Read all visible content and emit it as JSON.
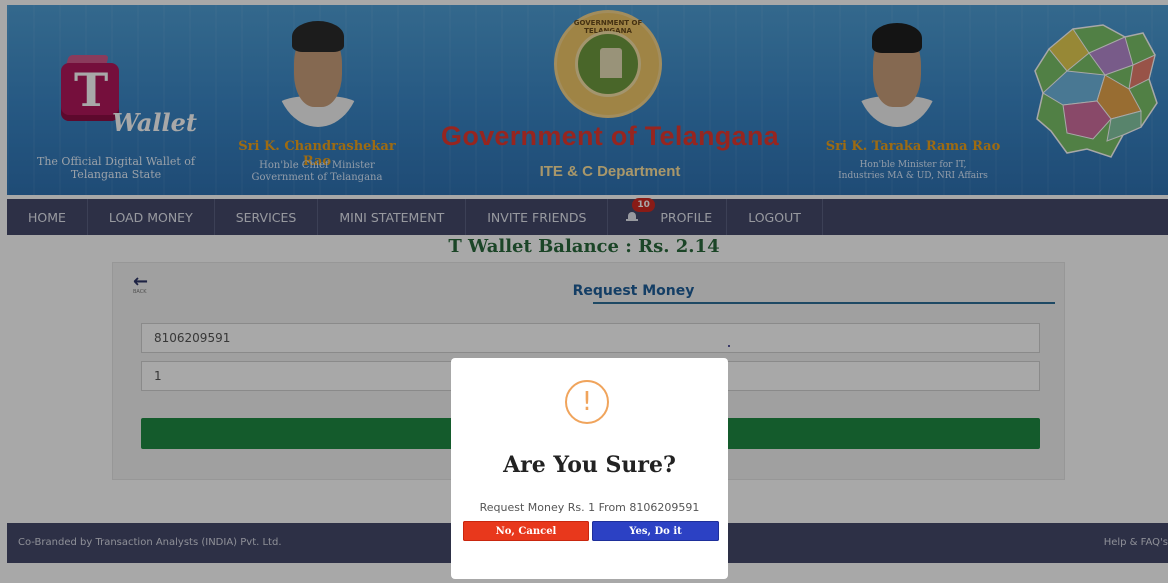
{
  "header": {
    "logo": {
      "letter": "T",
      "word": "Wallet"
    },
    "tagline_line1": "The Official Digital Wallet of",
    "tagline_line2": "Telangana State",
    "left_person": {
      "name": "Sri K. Chandrashekar Rao",
      "role1": "Hon'ble Chief Minister",
      "role2": "Government of Telangana"
    },
    "right_person": {
      "name": "Sri K. Taraka Rama Rao",
      "role1": "Hon'ble Minister for IT,",
      "role2": "Industries MA & UD, NRI Affairs"
    },
    "emblem_text": "GOVERNMENT OF TELANGANA",
    "gov_title": "Government of Telangana",
    "gov_subtitle": "ITE & C Department"
  },
  "nav": {
    "items": [
      "HOME",
      "LOAD MONEY",
      "SERVICES",
      "MINI STATEMENT",
      "INVITE FRIENDS"
    ],
    "notification_count": "10",
    "profile": "PROFILE",
    "logout": "LOGOUT"
  },
  "balance_text": "T Wallet Balance : Rs. 2.14",
  "form": {
    "back_label": "BACK",
    "title": "Request Money",
    "mobile_value": "8106209591",
    "amount_value": "1"
  },
  "footer": {
    "left": "Co-Branded by Transaction Analysts (INDIA) Pvt. Ltd.",
    "right": "Help & FAQ's"
  },
  "dialog": {
    "icon": "exclamation-icon",
    "title": "Are You Sure?",
    "message": "Request Money Rs. 1 From 8106209591",
    "cancel_label": "No, Cancel",
    "confirm_label": "Yes, Do it",
    "cancel_color": "#e8381c",
    "confirm_color": "#2c41c4"
  },
  "colors": {
    "banner": "#3a86c6",
    "nav": "#454a6b",
    "accent_green": "#1f8b43",
    "title_red": "#e5392f"
  }
}
